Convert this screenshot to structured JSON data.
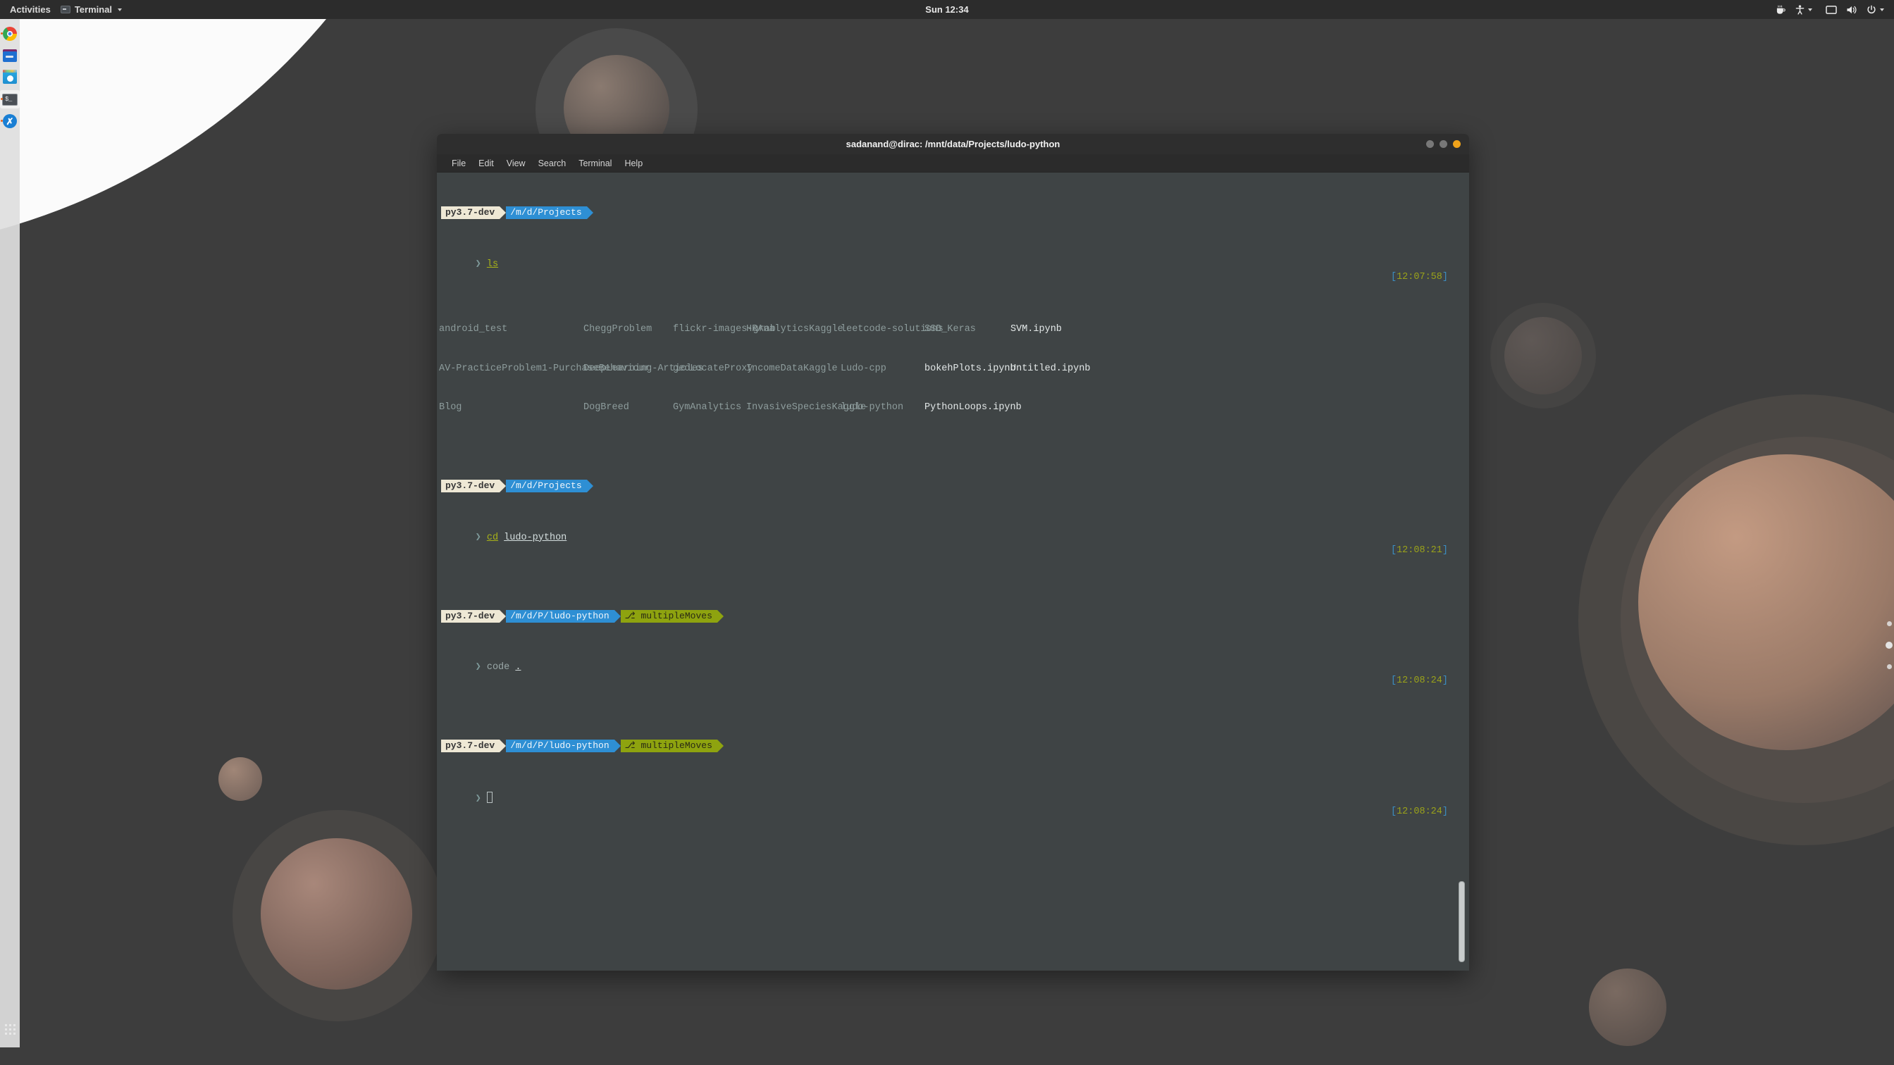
{
  "desktop": {
    "topbar": {
      "activities_label": "Activities",
      "app_name": "Terminal",
      "app_icon": "terminal-icon",
      "clock": "Sun 12:34",
      "system_icons": [
        "coffee-cup-icon",
        "accessibility-icon",
        "display-icon",
        "volume-icon",
        "power-icon"
      ]
    },
    "dock": {
      "items": [
        {
          "name": "chrome",
          "label": "Google Chrome",
          "running": true,
          "active": false
        },
        {
          "name": "files",
          "label": "Files",
          "running": false,
          "active": false
        },
        {
          "name": "software",
          "label": "Ubuntu Software",
          "running": false,
          "active": false
        },
        {
          "name": "terminal",
          "label": "Terminal",
          "running": true,
          "active": true,
          "glyph": "$_"
        },
        {
          "name": "vscode",
          "label": "Visual Studio Code",
          "running": true,
          "active": false,
          "glyph": "✗"
        }
      ],
      "show_apps_label": "Show Applications"
    },
    "workspace_dots": 3
  },
  "window": {
    "title": "sadanand@dirac: /mnt/data/Projects/ludo-python",
    "buttons": [
      {
        "name": "minimize",
        "color": "#787878"
      },
      {
        "name": "maximize",
        "color": "#787878"
      },
      {
        "name": "close",
        "color": "#f0a31a"
      }
    ],
    "menubar": [
      "File",
      "Edit",
      "View",
      "Search",
      "Terminal",
      "Help"
    ]
  },
  "terminal": {
    "colors": {
      "background": "#3f4445",
      "venv_segment": "#eee8d5",
      "path_segment": "#2e8fd4",
      "git_segment": "#8ea30f",
      "command": "#a8b218",
      "directory": "#8d9c9c",
      "file": "#e3e8e8",
      "timestamp_bracket": "#3b8ec2",
      "timestamp_digits": "#9aa21a"
    },
    "blocks": [
      {
        "prompt": {
          "venv": "py3.7-dev",
          "path": "/m/d/Projects",
          "git": null
        },
        "command_prefix": "❯ ",
        "command": "ls",
        "args": "",
        "timestamp": "[12:07:58]",
        "timestamp_open": "[",
        "timestamp_time": "12:07:58",
        "timestamp_close": "]",
        "listing": {
          "columns": [
            {
              "entries": [
                {
                  "text": "android_test",
                  "type": "dir"
                },
                {
                  "text": "AV-PracticeProblem1-PurchaseBehaviour",
                  "type": "dir"
                },
                {
                  "text": "Blog",
                  "type": "dir"
                }
              ]
            },
            {
              "entries": [
                {
                  "text": "CheggProblem",
                  "type": "dir"
                },
                {
                  "text": "DeepLearning-Articles",
                  "type": "dir"
                },
                {
                  "text": "DogBreed",
                  "type": "dir"
                }
              ]
            },
            {
              "entries": [
                {
                  "text": "flickr-images-grab",
                  "type": "dir"
                },
                {
                  "text": "geoLocateProxy",
                  "type": "dir"
                },
                {
                  "text": "GymAnalytics",
                  "type": "dir"
                }
              ]
            },
            {
              "entries": [
                {
                  "text": "HRAnalyticsKaggle",
                  "type": "dir"
                },
                {
                  "text": "IncomeDataKaggle",
                  "type": "dir"
                },
                {
                  "text": "InvasiveSpeciesKaggle",
                  "type": "dir"
                }
              ]
            },
            {
              "entries": [
                {
                  "text": "leetcode-solutions",
                  "type": "dir"
                },
                {
                  "text": "Ludo-cpp",
                  "type": "dir"
                },
                {
                  "text": "ludo-python",
                  "type": "dir"
                }
              ]
            },
            {
              "entries": [
                {
                  "text": "SSD_Keras",
                  "type": "dir"
                },
                {
                  "text": "bokehPlots.ipynb",
                  "type": "file"
                },
                {
                  "text": "PythonLoops.ipynb",
                  "type": "file"
                }
              ]
            },
            {
              "entries": [
                {
                  "text": "SVM.ipynb",
                  "type": "file"
                },
                {
                  "text": "Untitled.ipynb",
                  "type": "file"
                },
                {
                  "text": "",
                  "type": "file"
                }
              ]
            }
          ]
        }
      },
      {
        "prompt": {
          "venv": "py3.7-dev",
          "path": "/m/d/Projects",
          "git": null
        },
        "command_prefix": "❯ ",
        "command": "cd",
        "args": "ludo-python",
        "timestamp_open": "[",
        "timestamp_time": "12:08:21",
        "timestamp_close": "]"
      },
      {
        "prompt": {
          "venv": "py3.7-dev",
          "path": "/m/d/P/ludo-python",
          "git": "multipleMoves",
          "git_glyph": "⎇"
        },
        "command_prefix": "❯ ",
        "command": "code",
        "args": ".",
        "timestamp_open": "[",
        "timestamp_time": "12:08:24",
        "timestamp_close": "]"
      },
      {
        "prompt": {
          "venv": "py3.7-dev",
          "path": "/m/d/P/ludo-python",
          "git": "multipleMoves",
          "git_glyph": "⎇"
        },
        "command_prefix": "❯ ",
        "command": "",
        "args": "",
        "cursor": true,
        "timestamp_open": "[",
        "timestamp_time": "12:08:24",
        "timestamp_close": "]"
      }
    ]
  }
}
